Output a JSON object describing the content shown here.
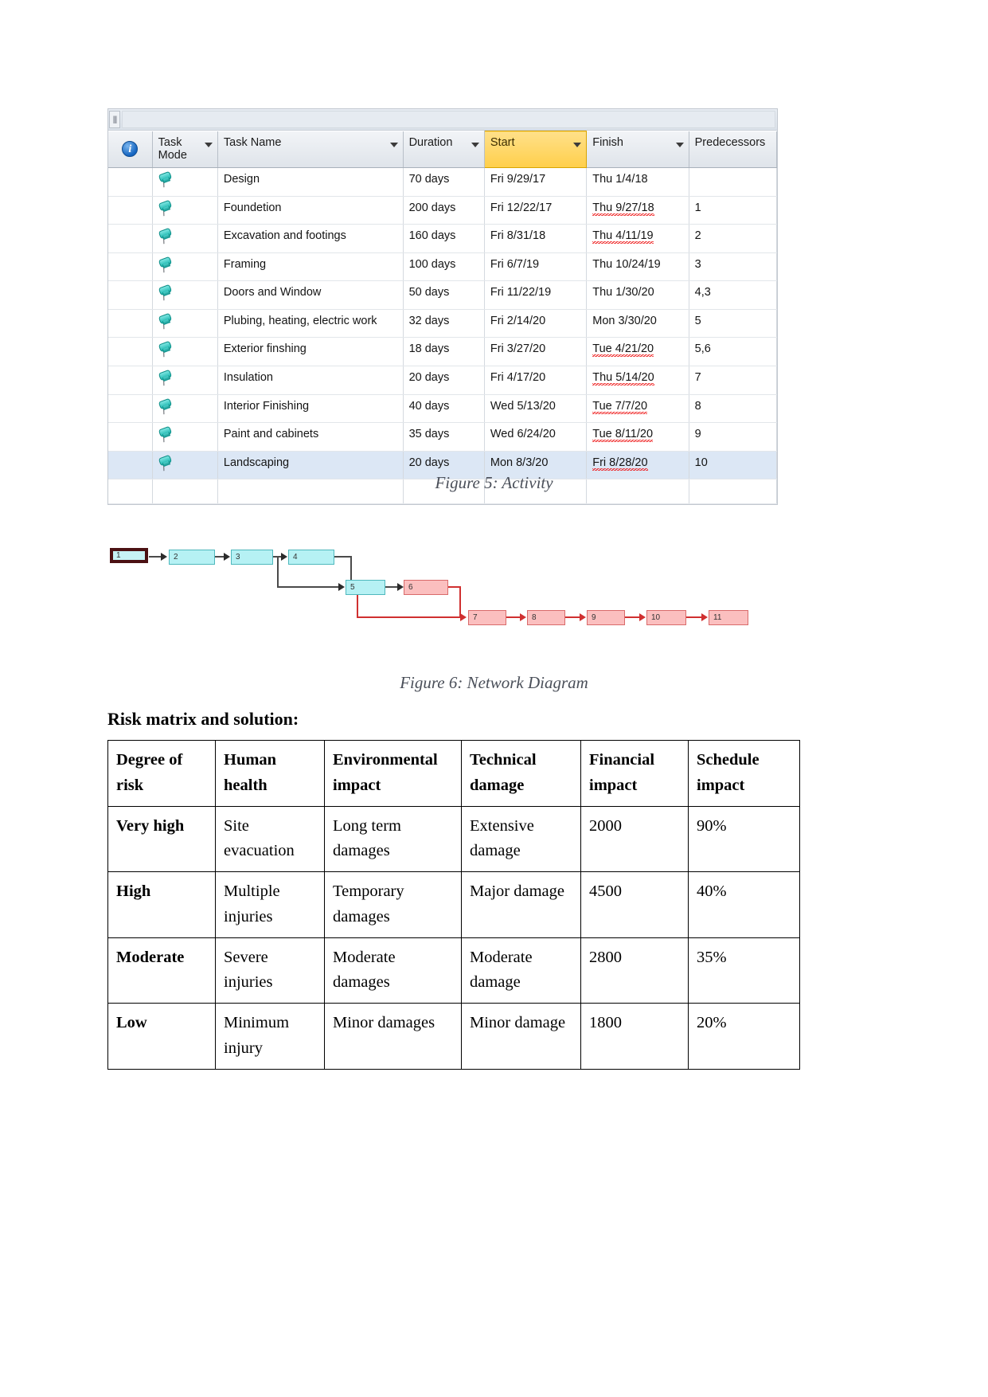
{
  "msproject": {
    "columns": [
      {
        "key": "indicator",
        "label": "",
        "icon": "info-icon"
      },
      {
        "key": "mode",
        "label": "Task Mode"
      },
      {
        "key": "name",
        "label": "Task Name"
      },
      {
        "key": "duration",
        "label": "Duration"
      },
      {
        "key": "start",
        "label": "Start"
      },
      {
        "key": "finish",
        "label": "Finish"
      },
      {
        "key": "predecessors",
        "label": "Predecessors"
      }
    ],
    "selected_column": "Start",
    "rows": [
      {
        "name": "Design",
        "duration": "70 days",
        "start": "Fri 9/29/17",
        "finish": "Thu 1/4/18",
        "misspelled_finish": false,
        "predecessors": "",
        "selected": false
      },
      {
        "name": "Foundetion",
        "duration": "200 days",
        "start": "Fri 12/22/17",
        "finish": "Thu 9/27/18",
        "misspelled_finish": true,
        "predecessors": "1",
        "selected": false
      },
      {
        "name": "Excavation and footings",
        "duration": "160 days",
        "start": "Fri 8/31/18",
        "finish": "Thu 4/11/19",
        "misspelled_finish": true,
        "predecessors": "2",
        "selected": false
      },
      {
        "name": "Framing",
        "duration": "100 days",
        "start": "Fri 6/7/19",
        "finish": "Thu 10/24/19",
        "misspelled_finish": false,
        "predecessors": "3",
        "selected": false
      },
      {
        "name": "Doors and Window",
        "duration": "50 days",
        "start": "Fri 11/22/19",
        "finish": "Thu 1/30/20",
        "misspelled_finish": false,
        "predecessors": "4,3",
        "selected": false
      },
      {
        "name": "Plubing, heating, electric work",
        "duration": "32 days",
        "start": "Fri 2/14/20",
        "finish": "Mon 3/30/20",
        "misspelled_finish": false,
        "predecessors": "5",
        "selected": false
      },
      {
        "name": "Exterior finshing",
        "duration": "18 days",
        "start": "Fri 3/27/20",
        "finish": "Tue 4/21/20",
        "misspelled_finish": true,
        "predecessors": "5,6",
        "selected": false
      },
      {
        "name": "Insulation",
        "duration": "20 days",
        "start": "Fri 4/17/20",
        "finish": "Thu 5/14/20",
        "misspelled_finish": true,
        "predecessors": "7",
        "selected": false
      },
      {
        "name": "Interior Finishing",
        "duration": "40 days",
        "start": "Wed 5/13/20",
        "finish": "Tue 7/7/20",
        "misspelled_finish": true,
        "predecessors": "8",
        "selected": false
      },
      {
        "name": "Paint and cabinets",
        "duration": "35 days",
        "start": "Wed 6/24/20",
        "finish": "Tue 8/11/20",
        "misspelled_finish": true,
        "predecessors": "9",
        "selected": false
      },
      {
        "name": "Landscaping",
        "duration": "20 days",
        "start": "Mon 8/3/20",
        "finish": "Fri 8/28/20",
        "misspelled_finish": true,
        "predecessors": "10",
        "selected": true
      }
    ]
  },
  "captions": {
    "activity": "Figure 5: Activity",
    "network": "Figure 6: Network Diagram"
  },
  "network_diagram": {
    "nodes": [
      {
        "id": "1",
        "label": "1",
        "style": "start"
      },
      {
        "id": "2",
        "label": "2",
        "style": "cyan"
      },
      {
        "id": "3",
        "label": "3",
        "style": "cyan"
      },
      {
        "id": "4",
        "label": "4",
        "style": "cyan"
      },
      {
        "id": "5",
        "label": "5",
        "style": "cyan"
      },
      {
        "id": "6",
        "label": "6",
        "style": "pink"
      },
      {
        "id": "7",
        "label": "7",
        "style": "pink"
      },
      {
        "id": "8",
        "label": "8",
        "style": "pink"
      },
      {
        "id": "9",
        "label": "9",
        "style": "pink"
      },
      {
        "id": "10",
        "label": "10",
        "style": "pink"
      },
      {
        "id": "11",
        "label": "11",
        "style": "pink"
      }
    ],
    "colors": {
      "cyan_fill": "#b6f1f4",
      "cyan_border": "#4fb8bd",
      "pink_fill": "#fbbfbf",
      "pink_border": "#d96a6a",
      "critical_border": "#4b1113",
      "link": "#4a4a4a",
      "link_critical": "#d03030"
    }
  },
  "risk_section": {
    "title": "Risk matrix and solution:",
    "headers": [
      "Degree of risk",
      "Human health",
      "Environmental impact",
      "Technical damage",
      "Financial impact",
      "Schedule impact"
    ],
    "rows": [
      [
        "Very high",
        "Site evacuation",
        "Long term damages",
        "Extensive damage",
        "2000",
        "90%"
      ],
      [
        "High",
        "Multiple injuries",
        "Temporary damages",
        "Major damage",
        "4500",
        "40%"
      ],
      [
        "Moderate",
        "Severe injuries",
        "Moderate damages",
        "Moderate damage",
        "2800",
        "35%"
      ],
      [
        "Low",
        "Minimum injury",
        "Minor damages",
        "Minor damage",
        "1800",
        "20%"
      ]
    ]
  }
}
